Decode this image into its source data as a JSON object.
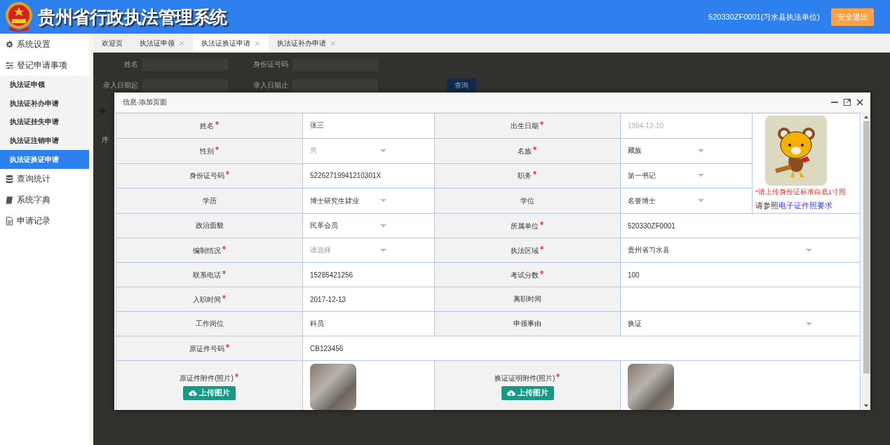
{
  "header": {
    "title": "贵州省行政执法管理系统",
    "user": "520330ZF0001(习水县执法单位)",
    "logout_button": "安全退出"
  },
  "sidebar": {
    "items": [
      {
        "label": "系统设置",
        "selected": false
      },
      {
        "label": "登记申请事项",
        "selected": false,
        "children": [
          {
            "label": "执法证申领",
            "selected": false
          },
          {
            "label": "执法证补办申请",
            "selected": false
          },
          {
            "label": "执法证挂失申请",
            "selected": false
          },
          {
            "label": "执法证注销申请",
            "selected": false
          },
          {
            "label": "执法证换证申请",
            "selected": true
          }
        ]
      },
      {
        "label": "查询统计",
        "selected": false
      },
      {
        "label": "系统字典",
        "selected": false
      },
      {
        "label": "申请记录",
        "selected": false
      }
    ]
  },
  "tabs": [
    {
      "label": "欢迎页",
      "closable": false,
      "selected": false
    },
    {
      "label": "执法证申领",
      "closable": true,
      "selected": false
    },
    {
      "label": "执法证换证申请",
      "closable": true,
      "selected": true
    },
    {
      "label": "执法证补办申请",
      "closable": true,
      "selected": false
    }
  ],
  "search_form": {
    "fields": [
      {
        "label": "姓名"
      },
      {
        "label": "身份证号码"
      },
      {
        "label": "录入日期起"
      },
      {
        "label": "录入日期止"
      }
    ],
    "search_button": "查询",
    "table_header": "序"
  },
  "dialog": {
    "title": "信息-添加页面",
    "rows": [
      {
        "fields": [
          {
            "label": "姓名",
            "value": "张三",
            "kind": "text",
            "required": true,
            "disabled": false
          },
          {
            "label": "出生日期",
            "value": "1994-12-10",
            "kind": "text",
            "required": true,
            "disabled": true
          }
        ]
      },
      {
        "fields": [
          {
            "label": "性别",
            "value": "男",
            "kind": "select",
            "required": true,
            "disabled": true
          },
          {
            "label": "名族",
            "value": "藏族",
            "kind": "select",
            "required": true,
            "disabled": false
          }
        ]
      },
      {
        "fields": [
          {
            "label": "身份证号码",
            "value": "52262719941210301X",
            "kind": "text",
            "required": true,
            "disabled": false
          },
          {
            "label": "职务",
            "value": "第一书记",
            "kind": "select",
            "required": true,
            "disabled": false
          }
        ]
      },
      {
        "fields": [
          {
            "label": "学历",
            "value": "博士研究生肄业",
            "kind": "select",
            "required": false,
            "disabled": false
          },
          {
            "label": "学位",
            "value": "名誉博士",
            "kind": "select",
            "required": false,
            "disabled": false
          }
        ]
      },
      {
        "fields": [
          {
            "label": "政治面貌",
            "value": "民革会员",
            "kind": "select",
            "required": false,
            "disabled": false
          },
          {
            "label": "所属单位",
            "value": "520330ZF0001",
            "kind": "text",
            "required": true,
            "disabled": false
          }
        ]
      },
      {
        "fields": [
          {
            "label": "编制情况",
            "placeholder": "请选择",
            "kind": "select",
            "required": true,
            "disabled": false
          },
          {
            "label": "执法区域",
            "value": "贵州省习水县",
            "kind": "select",
            "required": true,
            "disabled": false
          }
        ]
      },
      {
        "fields": [
          {
            "label": "联系电话",
            "value": "15285421256",
            "kind": "text",
            "required": true,
            "disabled": false
          },
          {
            "label": "考试分数",
            "value": "100",
            "kind": "text",
            "required": true,
            "disabled": false
          }
        ]
      },
      {
        "fields": [
          {
            "label": "入职时间",
            "value": "2017-12-13",
            "kind": "text",
            "required": true,
            "disabled": false
          },
          {
            "label": "离职时间",
            "kind": "text",
            "required": false
          }
        ]
      },
      {
        "fields": [
          {
            "label": "工作岗位",
            "value": "科员",
            "kind": "text",
            "required": false,
            "disabled": false
          },
          {
            "label": "申领事由",
            "value": "换证",
            "kind": "select",
            "required": false,
            "disabled": false
          }
        ]
      },
      {
        "fields": [
          {
            "label": "原证件号码",
            "value": "CB123456",
            "kind": "text",
            "required": true,
            "disabled": false
          }
        ]
      }
    ],
    "photo": {
      "hint": "*请上传身份证标准白底1寸照",
      "guide": "请参照",
      "guide_link": "电子证件照要求"
    },
    "uploads": [
      {
        "label": "原证件附件(照片)",
        "required": true,
        "button": "上传图片"
      },
      {
        "label": "换证证明附件(照片)",
        "required": true,
        "button": "上传图片"
      }
    ]
  }
}
